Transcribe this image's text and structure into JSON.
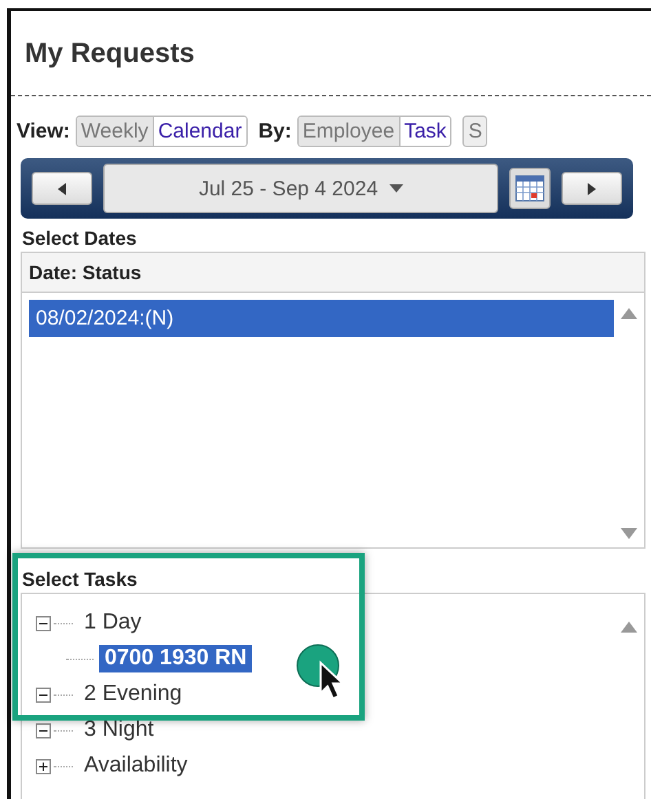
{
  "title": "My Requests",
  "view": {
    "label": "View:",
    "options": [
      {
        "label": "Weekly",
        "selected": false
      },
      {
        "label": "Calendar",
        "selected": true
      }
    ]
  },
  "by": {
    "label": "By:",
    "options": [
      {
        "label": "Employee",
        "selected": false
      },
      {
        "label": "Task",
        "selected": true
      }
    ]
  },
  "extra_button": "S",
  "date_range": "Jul 25 - Sep 4 2024",
  "select_dates": {
    "heading": "Select Dates",
    "column": "Date: Status",
    "rows": [
      {
        "label": "08/02/2024:(N)",
        "selected": true
      }
    ]
  },
  "select_tasks": {
    "heading": "Select Tasks",
    "tree": [
      {
        "label": "1 Day",
        "expanded": true,
        "selected": false,
        "children": [
          {
            "label": "0700 1930 RN",
            "selected": true
          }
        ]
      },
      {
        "label": "2 Evening",
        "expanded": true,
        "selected": false
      },
      {
        "label": "3 Night",
        "expanded": true,
        "selected": false
      },
      {
        "label": "Availability",
        "expanded": false,
        "selected": false
      }
    ]
  }
}
